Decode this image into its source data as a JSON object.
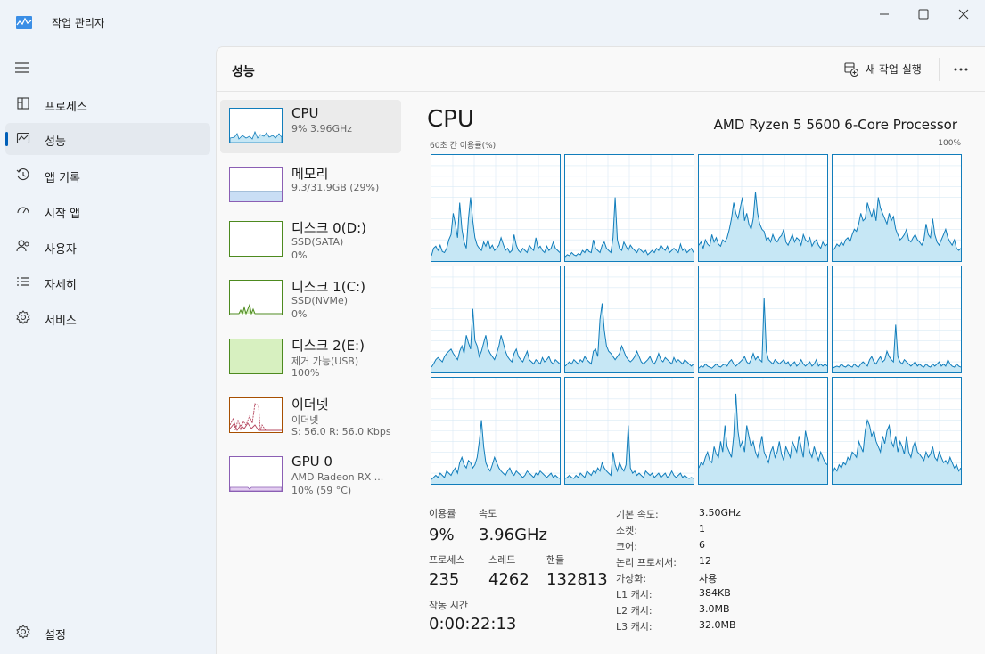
{
  "app": {
    "title": "작업 관리자"
  },
  "sidebar": {
    "items": [
      {
        "label": "프로세스",
        "icon": "processes-icon"
      },
      {
        "label": "성능",
        "icon": "performance-icon"
      },
      {
        "label": "앱 기록",
        "icon": "app-history-icon"
      },
      {
        "label": "시작 앱",
        "icon": "startup-apps-icon"
      },
      {
        "label": "사용자",
        "icon": "users-icon"
      },
      {
        "label": "자세히",
        "icon": "details-icon"
      },
      {
        "label": "서비스",
        "icon": "services-icon"
      }
    ],
    "settings_label": "설정",
    "active": "성능"
  },
  "header": {
    "title": "성능",
    "new_task_label": "새 작업 실행"
  },
  "devices": [
    {
      "name": "CPU",
      "sub1": "9% 3.96GHz",
      "sub2": ""
    },
    {
      "name": "메모리",
      "sub1": "9.3/31.9GB (29%)",
      "sub2": ""
    },
    {
      "name": "디스크 0(D:)",
      "sub1": "SSD(SATA)",
      "sub2": "0%"
    },
    {
      "name": "디스크 1(C:)",
      "sub1": "SSD(NVMe)",
      "sub2": "0%"
    },
    {
      "name": "디스크 2(E:)",
      "sub1": "제거 가능(USB)",
      "sub2": "100%"
    },
    {
      "name": "이더넷",
      "sub1": "이더넷",
      "sub2": "S: 56.0 R: 56.0 Kbps"
    },
    {
      "name": "GPU 0",
      "sub1": "AMD Radeon RX ...",
      "sub2": "10% (59 °C)"
    }
  ],
  "cpu": {
    "title": "CPU",
    "model": "AMD Ryzen 5 5600 6-Core Processor",
    "graph_caption": "60초 간 이용률(%)",
    "graph_max": "100%",
    "colors": {
      "line": "#117dbb",
      "fill": "#c6e7f5",
      "grid": "#d9eaf5"
    },
    "stats": {
      "usage_label": "이용률",
      "usage": "9%",
      "speed_label": "속도",
      "speed": "3.96GHz",
      "processes_label": "프로세스",
      "processes": "235",
      "threads_label": "스레드",
      "threads": "4262",
      "handles_label": "핸들",
      "handles": "132813",
      "uptime_label": "작동 시간",
      "uptime": "0:00:22:13"
    },
    "specs": [
      {
        "key": "기본 속도:",
        "value": "3.50GHz"
      },
      {
        "key": "소켓:",
        "value": "1"
      },
      {
        "key": "코어:",
        "value": "6"
      },
      {
        "key": "논리 프로세서:",
        "value": "12"
      },
      {
        "key": "가상화:",
        "value": "사용"
      },
      {
        "key": "L1 캐시:",
        "value": "384KB"
      },
      {
        "key": "L2 캐시:",
        "value": "3.0MB"
      },
      {
        "key": "L3 캐시:",
        "value": "32.0MB"
      }
    ],
    "cores": [
      [
        5,
        12,
        14,
        10,
        15,
        9,
        8,
        12,
        20,
        25,
        45,
        35,
        22,
        55,
        30,
        18,
        12,
        40,
        60,
        38,
        22,
        15,
        12,
        10,
        18,
        14,
        20,
        12,
        15,
        10,
        12,
        15,
        22,
        16,
        10,
        12,
        8,
        10,
        25,
        15,
        10,
        8,
        12,
        10,
        8,
        15,
        12,
        10,
        22,
        12,
        14,
        10,
        8,
        14,
        10,
        12,
        18,
        12,
        10,
        8
      ],
      [
        4,
        6,
        5,
        8,
        6,
        5,
        7,
        6,
        10,
        8,
        12,
        9,
        8,
        20,
        12,
        10,
        8,
        15,
        18,
        12,
        10,
        8,
        22,
        60,
        20,
        12,
        10,
        18,
        14,
        10,
        15,
        12,
        10,
        8,
        12,
        10,
        8,
        10,
        6,
        8,
        10,
        8,
        12,
        10,
        15,
        12,
        10,
        14,
        8,
        10,
        12,
        10,
        8,
        16,
        10,
        12,
        8,
        10,
        12,
        8
      ],
      [
        15,
        18,
        12,
        20,
        16,
        14,
        25,
        18,
        22,
        16,
        14,
        20,
        18,
        22,
        30,
        40,
        55,
        45,
        40,
        50,
        60,
        38,
        45,
        35,
        30,
        40,
        65,
        45,
        35,
        30,
        28,
        20,
        22,
        18,
        25,
        20,
        18,
        22,
        24,
        30,
        18,
        15,
        20,
        25,
        18,
        22,
        20,
        15,
        25,
        20,
        18,
        22,
        14,
        18,
        20,
        15,
        12,
        18,
        14,
        16
      ],
      [
        10,
        12,
        16,
        14,
        18,
        15,
        20,
        22,
        18,
        25,
        30,
        28,
        35,
        45,
        38,
        40,
        55,
        48,
        42,
        50,
        38,
        60,
        50,
        45,
        40,
        35,
        45,
        38,
        42,
        30,
        25,
        20,
        22,
        25,
        30,
        20,
        18,
        22,
        25,
        20,
        18,
        15,
        20,
        35,
        25,
        22,
        40,
        25,
        18,
        15,
        20,
        25,
        30,
        22,
        18,
        15,
        20,
        12,
        10,
        12
      ],
      [
        5,
        8,
        12,
        14,
        12,
        10,
        15,
        18,
        20,
        22,
        18,
        15,
        12,
        20,
        25,
        18,
        35,
        28,
        22,
        60,
        30,
        25,
        15,
        20,
        28,
        35,
        22,
        18,
        15,
        12,
        18,
        25,
        35,
        28,
        20,
        15,
        12,
        10,
        18,
        22,
        15,
        12,
        10,
        15,
        20,
        12,
        10,
        8,
        12,
        10,
        8,
        14,
        10,
        12,
        15,
        10,
        8,
        12,
        10,
        8
      ],
      [
        6,
        8,
        10,
        8,
        12,
        10,
        8,
        12,
        10,
        15,
        12,
        10,
        8,
        20,
        22,
        15,
        50,
        65,
        40,
        25,
        20,
        18,
        15,
        12,
        15,
        18,
        25,
        20,
        15,
        12,
        10,
        12,
        15,
        20,
        15,
        10,
        8,
        10,
        12,
        15,
        10,
        8,
        12,
        18,
        12,
        10,
        14,
        12,
        10,
        8,
        14,
        10,
        12,
        10,
        8,
        12,
        10,
        8,
        6,
        8
      ],
      [
        4,
        6,
        5,
        8,
        6,
        5,
        4,
        6,
        8,
        6,
        5,
        7,
        8,
        6,
        10,
        12,
        8,
        6,
        8,
        10,
        12,
        15,
        10,
        8,
        12,
        18,
        12,
        15,
        12,
        10,
        70,
        20,
        12,
        10,
        8,
        12,
        10,
        8,
        10,
        12,
        8,
        10,
        6,
        8,
        10,
        6,
        8,
        12,
        8,
        6,
        8,
        10,
        6,
        8,
        12,
        6,
        8,
        6,
        8,
        6
      ],
      [
        4,
        5,
        6,
        5,
        8,
        6,
        5,
        7,
        6,
        5,
        8,
        6,
        5,
        8,
        10,
        8,
        6,
        12,
        15,
        10,
        8,
        12,
        15,
        10,
        12,
        20,
        15,
        12,
        10,
        45,
        15,
        10,
        8,
        12,
        10,
        8,
        6,
        8,
        10,
        6,
        8,
        6,
        5,
        8,
        6,
        5,
        8,
        6,
        8,
        10,
        6,
        8,
        6,
        12,
        8,
        6,
        5,
        8,
        6,
        5
      ],
      [
        4,
        6,
        8,
        6,
        10,
        8,
        6,
        12,
        10,
        8,
        12,
        15,
        10,
        20,
        25,
        18,
        15,
        22,
        20,
        15,
        18,
        25,
        40,
        60,
        35,
        20,
        15,
        12,
        18,
        25,
        20,
        15,
        12,
        10,
        8,
        12,
        15,
        10,
        8,
        12,
        10,
        8,
        6,
        8,
        12,
        10,
        8,
        6,
        10,
        8,
        12,
        10,
        8,
        6,
        8,
        10,
        6,
        8,
        6,
        5
      ],
      [
        5,
        6,
        8,
        6,
        5,
        8,
        6,
        10,
        8,
        6,
        12,
        10,
        8,
        12,
        10,
        15,
        12,
        20,
        15,
        12,
        10,
        8,
        30,
        18,
        12,
        20,
        15,
        12,
        18,
        55,
        15,
        10,
        12,
        8,
        10,
        8,
        6,
        12,
        10,
        8,
        10,
        6,
        8,
        10,
        6,
        8,
        10,
        6,
        8,
        12,
        8,
        6,
        8,
        10,
        6,
        8,
        6,
        5,
        6,
        5
      ],
      [
        15,
        20,
        18,
        25,
        30,
        22,
        20,
        35,
        28,
        25,
        40,
        30,
        55,
        35,
        30,
        25,
        45,
        85,
        50,
        35,
        40,
        30,
        55,
        45,
        35,
        40,
        30,
        25,
        35,
        45,
        30,
        25,
        20,
        30,
        35,
        25,
        30,
        40,
        28,
        22,
        35,
        30,
        25,
        40,
        35,
        30,
        45,
        35,
        25,
        50,
        40,
        30,
        25,
        35,
        28,
        22,
        30,
        25,
        20,
        18
      ],
      [
        10,
        15,
        12,
        18,
        15,
        20,
        18,
        25,
        22,
        30,
        28,
        25,
        40,
        35,
        30,
        50,
        60,
        55,
        45,
        50,
        40,
        35,
        30,
        45,
        38,
        50,
        55,
        40,
        35,
        45,
        30,
        40,
        35,
        28,
        45,
        30,
        25,
        35,
        40,
        30,
        28,
        25,
        22,
        30,
        25,
        28,
        35,
        25,
        22,
        30,
        25,
        20,
        22,
        18,
        25,
        20,
        15,
        18,
        12,
        15
      ]
    ]
  }
}
